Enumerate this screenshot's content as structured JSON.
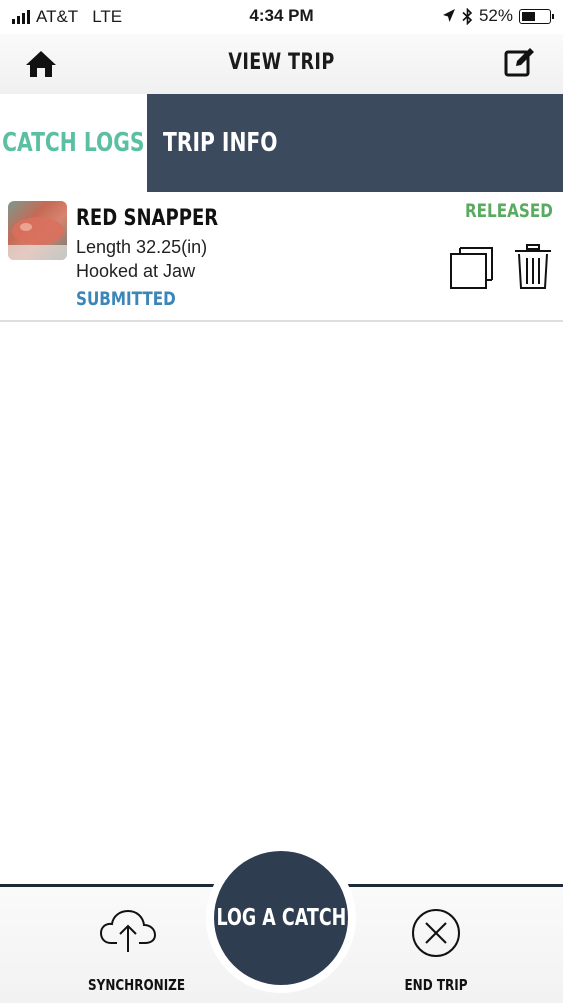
{
  "status_bar": {
    "carrier": "AT&T",
    "network": "LTE",
    "time": "4:34 PM",
    "battery_percent": "52%",
    "battery_level": 0.52
  },
  "nav": {
    "title": "VIEW TRIP",
    "left_icon": "home-icon",
    "right_icon": "edit-icon"
  },
  "tabs": [
    {
      "label": "CATCH LOGS",
      "active": true
    },
    {
      "label": "TRIP INFO",
      "active": false
    }
  ],
  "catch_logs": [
    {
      "species": "RED SNAPPER",
      "length": "Length 32.25(in)",
      "hooked": "Hooked at Jaw",
      "submission_status": "SUBMITTED",
      "disposition": "RELEASED"
    }
  ],
  "bottom_bar": {
    "sync_label": "SYNCHRONIZE",
    "log_catch_label": "LOG A CATCH",
    "end_trip_label": "END TRIP"
  },
  "colors": {
    "accent_teal": "#5bbfa2",
    "navy": "#3c4a5e",
    "button_navy": "#2f3d51",
    "released_green": "#5aaa62",
    "submitted_blue": "#3a86b8"
  }
}
